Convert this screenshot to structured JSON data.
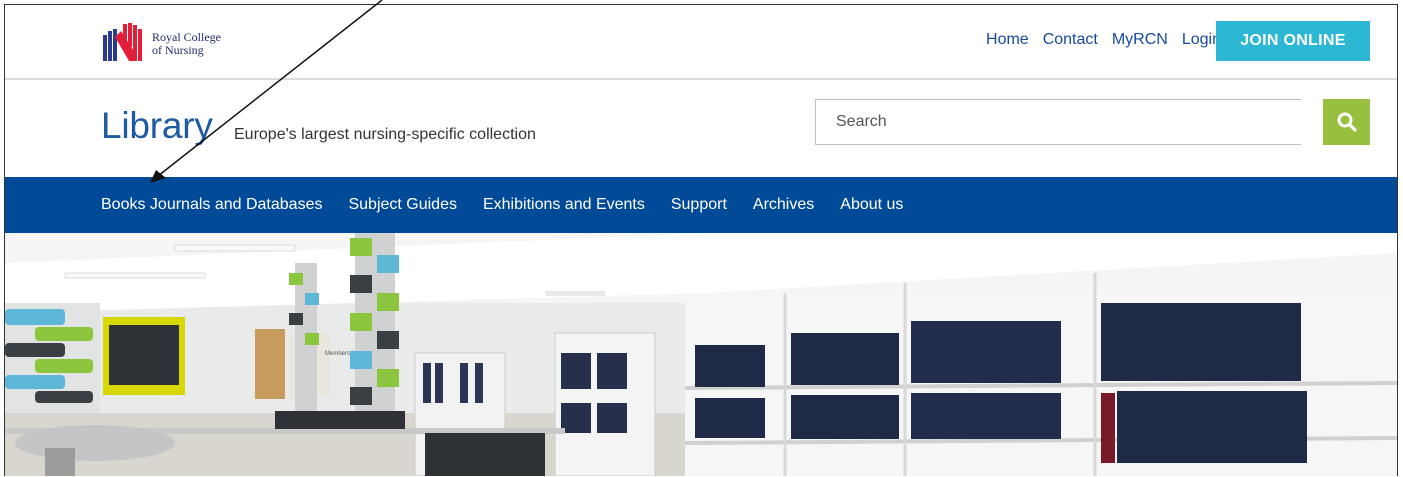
{
  "brand": {
    "name_line1": "Royal College",
    "name_line2": "of Nursing",
    "logo_colors": [
      "#2a3a8f",
      "#e31e3a"
    ]
  },
  "utility_nav": {
    "items": [
      "Home",
      "Contact",
      "MyRCN",
      "Login"
    ],
    "join_label": "JOIN ONLINE"
  },
  "header": {
    "title": "Library",
    "subtitle": "Europe's largest nursing-specific collection"
  },
  "search": {
    "placeholder": "Search",
    "icon": "search-icon"
  },
  "main_nav": {
    "items": [
      "Books Journals and Databases",
      "Subject Guides",
      "Exhibitions and Events",
      "Support",
      "Archives",
      "About us"
    ]
  },
  "hero": {
    "sign_text": "Members lounge"
  },
  "colors": {
    "link": "#164a9b",
    "join": "#2cb7d4",
    "search_button": "#96c03d",
    "nav": "#004a97",
    "title": "#1d5aa3"
  }
}
